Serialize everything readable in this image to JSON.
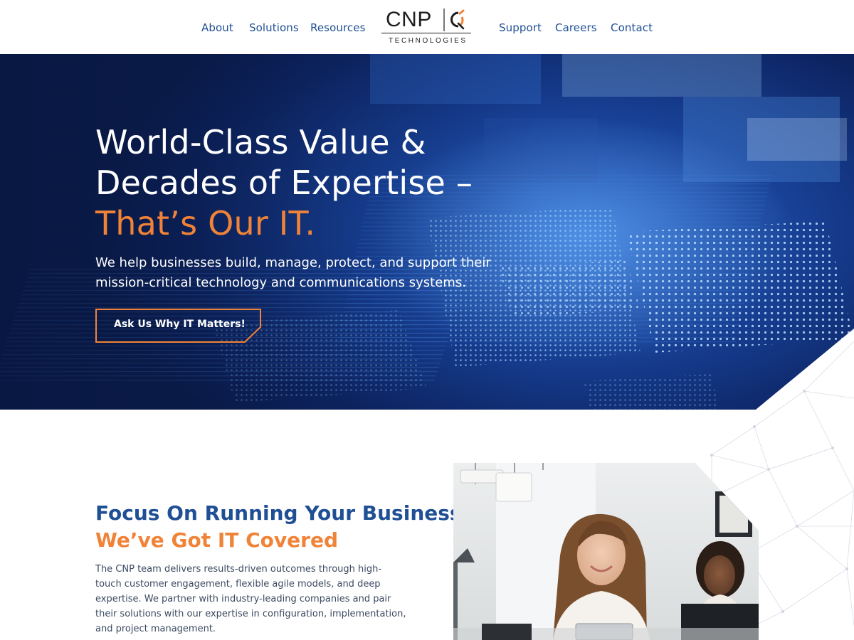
{
  "header": {
    "nav_left": [
      "About",
      "Solutions",
      "Resources"
    ],
    "nav_right": [
      "Support",
      "Careers",
      "Contact"
    ],
    "logo": {
      "word": "CNP",
      "sub": "TECHNOLOGIES"
    }
  },
  "hero": {
    "title_lines": [
      "World-Class Value &",
      "Decades of Expertise –"
    ],
    "title_accent": "That’s Our IT.",
    "subtitle_lines": [
      "We help businesses build, manage, protect, and support their",
      "mission-critical technology and communications systems."
    ],
    "cta_label": "Ask Us Why IT Matters!"
  },
  "focus": {
    "heading_line": "Focus On Running Your Business,",
    "heading_accent": "We’ve Got IT Covered",
    "body_lines": [
      "The CNP team delivers results-driven outcomes through high-",
      "touch customer engagement, flexible agile models, and deep",
      "expertise. We partner with industry-leading companies and pair",
      "their solutions with our expertise in configuration, implementation,",
      "and project management."
    ]
  },
  "colors": {
    "brand_blue": "#1f4f94",
    "accent_orange": "#f08338",
    "hero_dark": "#0d2462"
  },
  "icons": [
    "cnp-logo-mark-icon"
  ]
}
